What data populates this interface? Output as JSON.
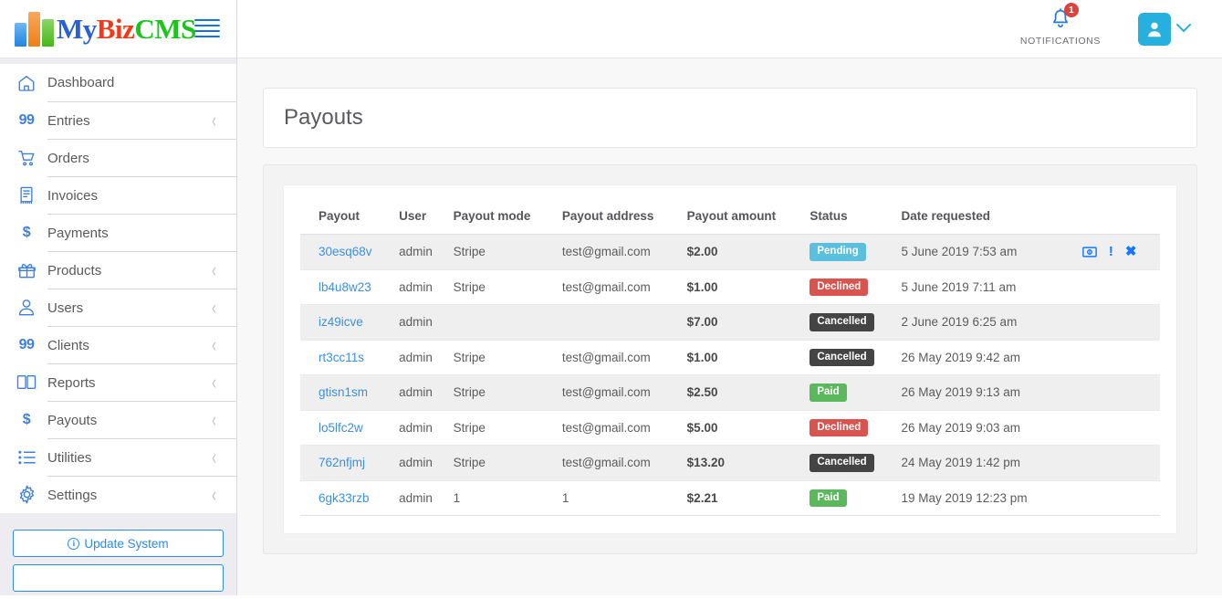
{
  "brand": {
    "text_my": "My",
    "text_biz": "Biz",
    "text_cms": "CMS",
    "menu_toggle": "hamburger-menu"
  },
  "sidebar": {
    "items": [
      {
        "label": "Dashboard",
        "icon": "home-icon",
        "has_caret": false,
        "caret": "‹"
      },
      {
        "label": "Entries",
        "icon": "quote-99-icon",
        "has_caret": true,
        "caret": "‹",
        "glyph": "99"
      },
      {
        "label": "Orders",
        "icon": "cart-icon",
        "has_caret": false,
        "caret": "‹"
      },
      {
        "label": "Invoices",
        "icon": "invoice-icon",
        "has_caret": false,
        "caret": "‹"
      },
      {
        "label": "Payments",
        "icon": "dollar-icon",
        "has_caret": false,
        "caret": "‹",
        "glyph": "$"
      },
      {
        "label": "Products",
        "icon": "gift-icon",
        "has_caret": true,
        "caret": "‹"
      },
      {
        "label": "Users",
        "icon": "user-icon",
        "has_caret": true,
        "caret": "‹"
      },
      {
        "label": "Clients",
        "icon": "quote-99-icon",
        "has_caret": true,
        "caret": "‹",
        "glyph": "99"
      },
      {
        "label": "Reports",
        "icon": "book-icon",
        "has_caret": true,
        "caret": "‹"
      },
      {
        "label": "Payouts",
        "icon": "dollar-icon",
        "has_caret": true,
        "caret": "‹",
        "glyph": "$"
      },
      {
        "label": "Utilities",
        "icon": "list-icon",
        "has_caret": true,
        "caret": "‹"
      },
      {
        "label": "Settings",
        "icon": "gear-icon",
        "has_caret": true,
        "caret": "‹"
      }
    ],
    "update_button": "Update System",
    "update_info_glyph": "i"
  },
  "header": {
    "notifications_label": "NOTIFICATIONS",
    "notifications_count": "1",
    "bell_icon": "bell-icon",
    "avatar_icon": "user-avatar-icon",
    "chevron": "⌄"
  },
  "page": {
    "title": "Payouts"
  },
  "table": {
    "columns": [
      "Payout",
      "User",
      "Payout mode",
      "Payout address",
      "Payout amount",
      "Status",
      "Date requested"
    ],
    "rows": [
      {
        "payout": "30esq68v",
        "user": "admin",
        "mode": "Stripe",
        "address": "test@gmail.com",
        "amount": "$2.00",
        "status": "Pending",
        "status_class": "badge-pending",
        "date": "5 June 2019 7:53 am",
        "actions": true
      },
      {
        "payout": "lb4u8w23",
        "user": "admin",
        "mode": "Stripe",
        "address": "test@gmail.com",
        "amount": "$1.00",
        "status": "Declined",
        "status_class": "badge-declined",
        "date": "5 June 2019 7:11 am",
        "actions": false
      },
      {
        "payout": "iz49icve",
        "user": "admin",
        "mode": "",
        "address": "",
        "amount": "$7.00",
        "status": "Cancelled",
        "status_class": "badge-cancelled",
        "date": "2 June 2019 6:25 am",
        "actions": false
      },
      {
        "payout": "rt3cc11s",
        "user": "admin",
        "mode": "Stripe",
        "address": "test@gmail.com",
        "amount": "$1.00",
        "status": "Cancelled",
        "status_class": "badge-cancelled",
        "date": "26 May 2019 9:42 am",
        "actions": false
      },
      {
        "payout": "gtisn1sm",
        "user": "admin",
        "mode": "Stripe",
        "address": "test@gmail.com",
        "amount": "$2.50",
        "status": "Paid",
        "status_class": "badge-paid",
        "date": "26 May 2019 9:13 am",
        "actions": false
      },
      {
        "payout": "lo5lfc2w",
        "user": "admin",
        "mode": "Stripe",
        "address": "test@gmail.com",
        "amount": "$5.00",
        "status": "Declined",
        "status_class": "badge-declined",
        "date": "26 May 2019 9:03 am",
        "actions": false
      },
      {
        "payout": "762nfjmj",
        "user": "admin",
        "mode": "Stripe",
        "address": "test@gmail.com",
        "amount": "$13.20",
        "status": "Cancelled",
        "status_class": "badge-cancelled",
        "date": "24 May 2019 1:42 pm",
        "actions": false
      },
      {
        "payout": "6gk33rzb",
        "user": "admin",
        "mode": "1",
        "address": "1",
        "amount": "$2.21",
        "status": "Paid",
        "status_class": "badge-paid",
        "date": "19 May 2019 12:23 pm",
        "actions": false
      }
    ],
    "row_action_icons": {
      "pay": "money-bill-icon",
      "flag": "exclamation-icon",
      "cancel": "close-x-icon",
      "flag_glyph": "!",
      "cancel_glyph": "✖"
    }
  },
  "colors": {
    "accent_blue": "#3a8fe6",
    "pending": "#5bc0de",
    "declined": "#d9534f",
    "cancelled": "#444444",
    "paid": "#5cb85c",
    "badge_red": "#d9443f",
    "avatar_cyan": "#27b0de"
  }
}
